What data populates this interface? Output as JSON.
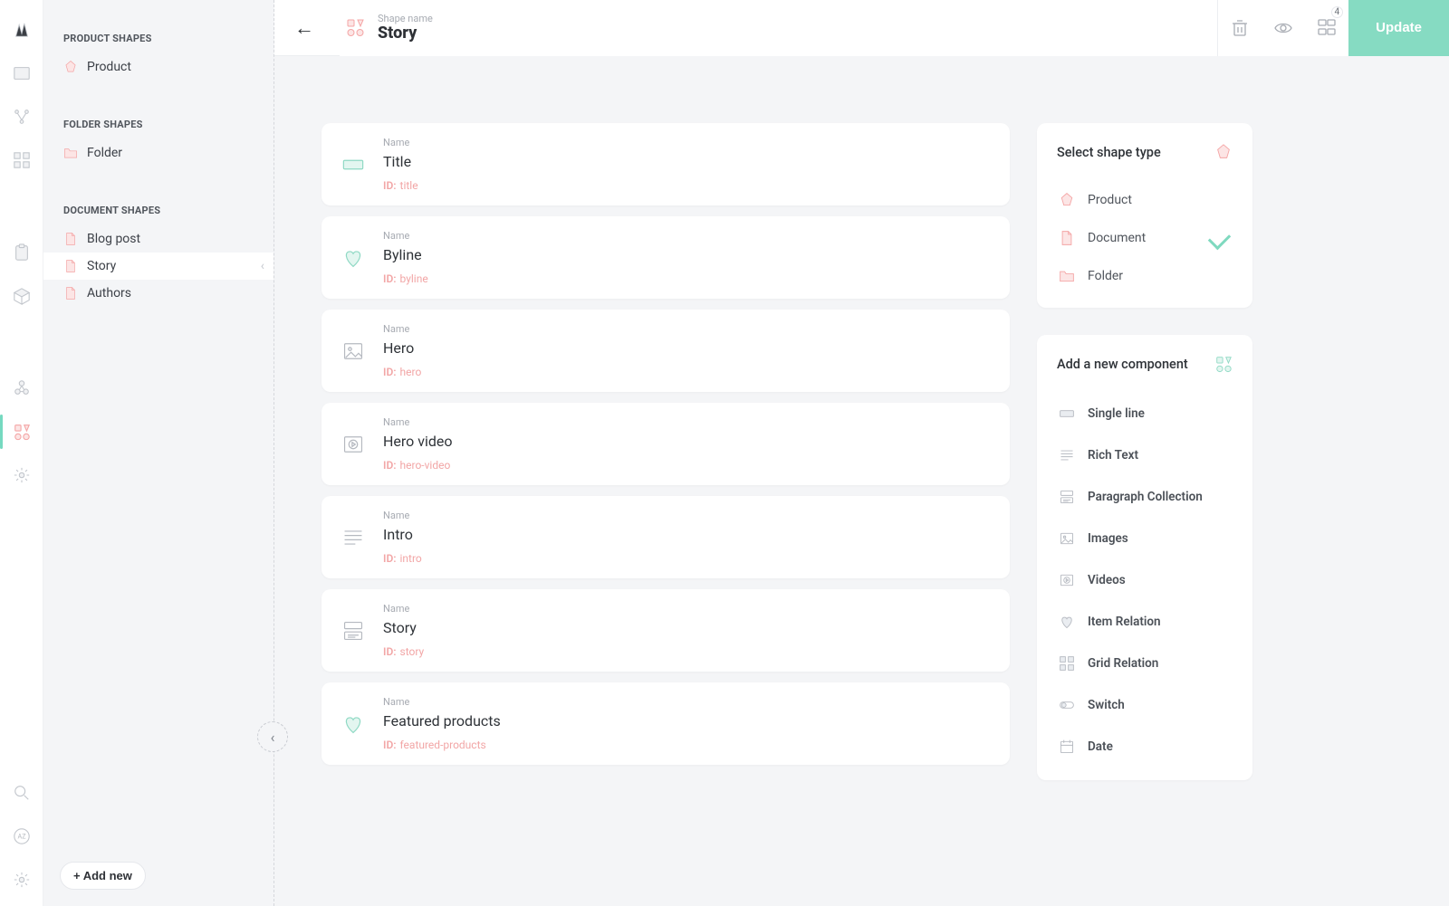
{
  "sidebar": {
    "sections": [
      {
        "heading": "PRODUCT SHAPES",
        "items": [
          {
            "label": "Product",
            "name": "sidebar-item-product",
            "iconClass": "ico-product"
          }
        ]
      },
      {
        "heading": "FOLDER SHAPES",
        "items": [
          {
            "label": "Folder",
            "name": "sidebar-item-folder",
            "iconClass": "ico-folder"
          }
        ]
      },
      {
        "heading": "DOCUMENT SHAPES",
        "items": [
          {
            "label": "Blog post",
            "name": "sidebar-item-blog-post",
            "iconClass": "ico-doc"
          },
          {
            "label": "Story",
            "name": "sidebar-item-story",
            "iconClass": "ico-doc",
            "selected": true
          },
          {
            "label": "Authors",
            "name": "sidebar-item-authors",
            "iconClass": "ico-doc"
          }
        ]
      }
    ],
    "add_new_label": "+ Add new"
  },
  "header": {
    "eyebrow": "Shape name",
    "title": "Story",
    "badge_count": "4",
    "update_label": "Update"
  },
  "components": [
    {
      "eyebrow": "Name",
      "name": "Title",
      "id_prefix": "ID:",
      "id": "title",
      "dname": "component-title",
      "icon": "textfield"
    },
    {
      "eyebrow": "Name",
      "name": "Byline",
      "id_prefix": "ID:",
      "id": "byline",
      "dname": "component-byline",
      "icon": "heart"
    },
    {
      "eyebrow": "Name",
      "name": "Hero",
      "id_prefix": "ID:",
      "id": "hero",
      "dname": "component-hero",
      "icon": "image"
    },
    {
      "eyebrow": "Name",
      "name": "Hero video",
      "id_prefix": "ID:",
      "id": "hero-video",
      "dname": "component-hero-video",
      "icon": "video"
    },
    {
      "eyebrow": "Name",
      "name": "Intro",
      "id_prefix": "ID:",
      "id": "intro",
      "dname": "component-intro",
      "icon": "richtext"
    },
    {
      "eyebrow": "Name",
      "name": "Story",
      "id_prefix": "ID:",
      "id": "story",
      "dname": "component-story",
      "icon": "paragraph"
    },
    {
      "eyebrow": "Name",
      "name": "Featured products",
      "id_prefix": "ID:",
      "id": "featured-products",
      "dname": "component-featured-products",
      "icon": "heart"
    }
  ],
  "right": {
    "shape_type": {
      "title": "Select shape type",
      "items": [
        {
          "label": "Product",
          "name": "shape-type-product",
          "iconClass": "ico-product"
        },
        {
          "label": "Document",
          "name": "shape-type-document",
          "iconClass": "ico-doc",
          "selected": true
        },
        {
          "label": "Folder",
          "name": "shape-type-folder",
          "iconClass": "ico-folder"
        }
      ]
    },
    "add_component": {
      "title": "Add a new component",
      "items": [
        {
          "label": "Single line",
          "name": "add-single-line",
          "icon": "textfield"
        },
        {
          "label": "Rich Text",
          "name": "add-rich-text",
          "icon": "richtext"
        },
        {
          "label": "Paragraph Collection",
          "name": "add-paragraph-collection",
          "icon": "paragraph"
        },
        {
          "label": "Images",
          "name": "add-images",
          "icon": "image"
        },
        {
          "label": "Videos",
          "name": "add-videos",
          "icon": "video"
        },
        {
          "label": "Item Relation",
          "name": "add-item-relation",
          "icon": "heart"
        },
        {
          "label": "Grid Relation",
          "name": "add-grid-relation",
          "icon": "grid"
        },
        {
          "label": "Switch",
          "name": "add-switch",
          "icon": "switch"
        },
        {
          "label": "Date",
          "name": "add-date",
          "icon": "date"
        }
      ]
    }
  }
}
